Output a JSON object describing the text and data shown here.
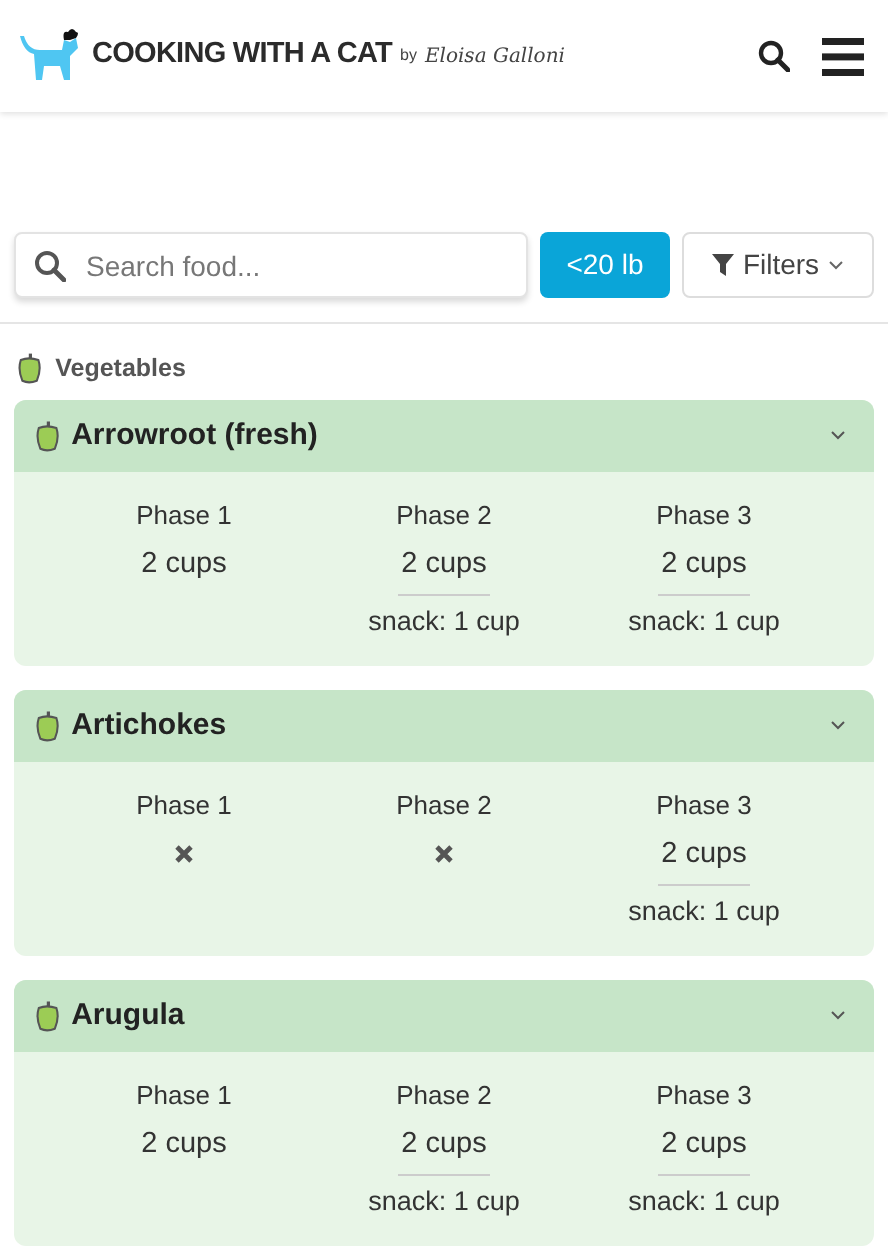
{
  "header": {
    "brand": "COOKING WITH A CAT",
    "by": "by",
    "signature": "Eloisa Galloni"
  },
  "search": {
    "placeholder": "Search food..."
  },
  "weight_button": {
    "label": "<20 lb",
    "selected": true
  },
  "filters_button": {
    "label": "Filters"
  },
  "category": {
    "label": "Vegetables"
  },
  "foods": [
    {
      "name": "Arrowroot (fresh)",
      "expanded": true,
      "phases": [
        {
          "label": "Phase 1",
          "kind": "amount",
          "amount": "2 cups"
        },
        {
          "label": "Phase 2",
          "kind": "amount",
          "amount": "2 cups",
          "snack": "snack: 1 cup"
        },
        {
          "label": "Phase 3",
          "kind": "amount",
          "amount": "2 cups",
          "snack": "snack: 1 cup"
        }
      ]
    },
    {
      "name": "Artichokes",
      "expanded": true,
      "phases": [
        {
          "label": "Phase 1",
          "kind": "none"
        },
        {
          "label": "Phase 2",
          "kind": "none"
        },
        {
          "label": "Phase 3",
          "kind": "amount",
          "amount": "2 cups",
          "snack": "snack: 1 cup"
        }
      ]
    },
    {
      "name": "Arugula",
      "expanded": true,
      "phases": [
        {
          "label": "Phase 1",
          "kind": "amount",
          "amount": "2 cups"
        },
        {
          "label": "Phase 2",
          "kind": "amount",
          "amount": "2 cups",
          "snack": "snack: 1 cup"
        },
        {
          "label": "Phase 3",
          "kind": "amount",
          "amount": "2 cups",
          "snack": "snack: 1 cup"
        }
      ]
    }
  ]
}
